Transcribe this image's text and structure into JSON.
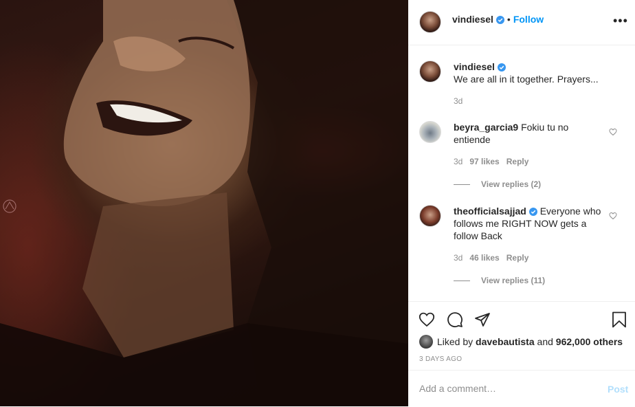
{
  "post": {
    "image_description_icon": "photo",
    "owner": {
      "username": "vindiesel",
      "verified": true,
      "follow_label": "Follow",
      "separator": "•"
    },
    "more_icon": "more-options-icon",
    "more_label": "•••"
  },
  "caption": {
    "username": "vindiesel",
    "text": "We are all in it together. Prayers...",
    "time": "3d"
  },
  "comments": [
    {
      "username": "beyra_garcia9",
      "verified": false,
      "text": "Fokiu tu no entiende",
      "time": "3d",
      "likes": "97 likes",
      "reply_label": "Reply",
      "view_replies": "View replies (2)"
    },
    {
      "username": "theofficialsajjad",
      "verified": true,
      "text": "Everyone who follows me RIGHT NOW gets a follow Back",
      "time": "3d",
      "likes": "46 likes",
      "reply_label": "Reply",
      "view_replies": "View replies (11)"
    }
  ],
  "actions": {
    "liked_by_prefix": "Liked by",
    "liked_by_user": "davebautista",
    "and": "and",
    "others": "962,000 others",
    "time_ago": "3 DAYS AGO"
  },
  "add_comment": {
    "placeholder": "Add a comment…",
    "post_label": "Post"
  },
  "colors": {
    "link_blue": "#0095f6",
    "verified_blue": "#3897f0",
    "muted": "#8e8e8e",
    "post_disabled": "#b2dffc"
  }
}
